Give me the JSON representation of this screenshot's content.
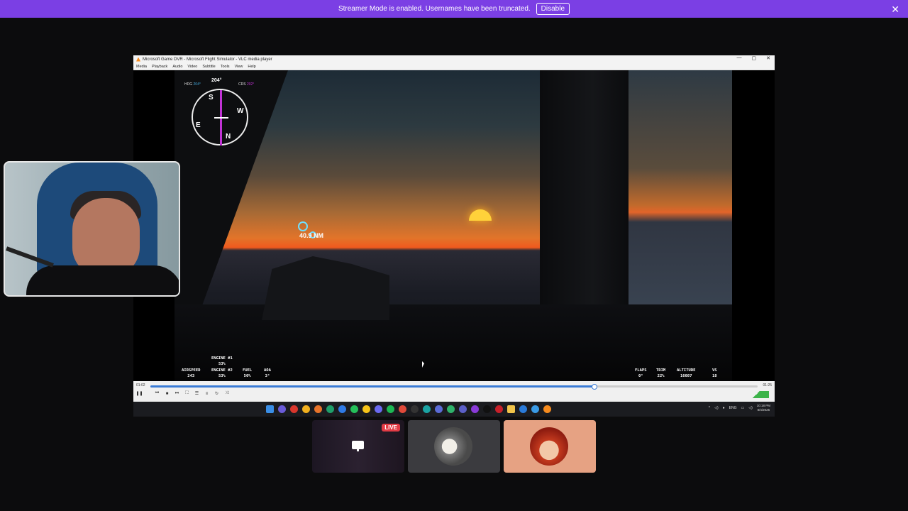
{
  "banner": {
    "message": "Streamer Mode is enabled. Usernames have been truncated.",
    "disable_label": "Disable",
    "close_glyph": "✕",
    "color": "#7b3fe4"
  },
  "vlc": {
    "title": "Microsoft Game DVR - Microsoft Flight Simulator - VLC media player",
    "window_controls": [
      "—",
      "▢",
      "✕"
    ],
    "menu": [
      "Media",
      "Playback",
      "Audio",
      "Video",
      "Subtitle",
      "Tools",
      "View",
      "Help"
    ],
    "time_elapsed": "01:02",
    "time_total": "01:25",
    "progress_fraction": 0.73,
    "volume_label": "100%"
  },
  "hud": {
    "hdg_label": "HDG",
    "hdg_value": "204°",
    "crs_label": "CRS",
    "crs_value": "202°",
    "heading_top": "204°",
    "compass_letters": [
      "S",
      "E",
      "W",
      "N"
    ],
    "waypoint_distance": "40.9 NM",
    "engine1_label": "ENGINE #1",
    "engine1_value": "53%",
    "airspeed_label": "AIRSPEED",
    "airspeed_value": "243",
    "engine2_label": "ENGINE #2",
    "engine2_value": "53%",
    "fuel_label": "FUEL",
    "fuel_value": "50%",
    "aoa_label": "AOA",
    "aoa_value": "3°",
    "flaps_label": "FLAPS",
    "flaps_value": "0°",
    "trim_label": "TRIM",
    "trim_value": "22%",
    "altitude_label": "ALTITUDE",
    "altitude_value": "16087",
    "vs_label": "VS",
    "vs_value": "18"
  },
  "taskbar": {
    "icons": [
      "windows-start",
      "copilot",
      "media",
      "chrome",
      "firefox",
      "edge",
      "todo",
      "whatsapp",
      "norton",
      "messenger",
      "spotify",
      "app-red",
      "app-dark",
      "app-teal",
      "app-mesh",
      "app-green",
      "teams",
      "app-purple",
      "app-black",
      "app-red2",
      "file-explorer",
      "app-blue",
      "app-store",
      "vlc"
    ],
    "lang": "ENG",
    "time": "10:18 PM",
    "date": "8/4/2025"
  },
  "tiles": {
    "live_label": "LIVE"
  }
}
